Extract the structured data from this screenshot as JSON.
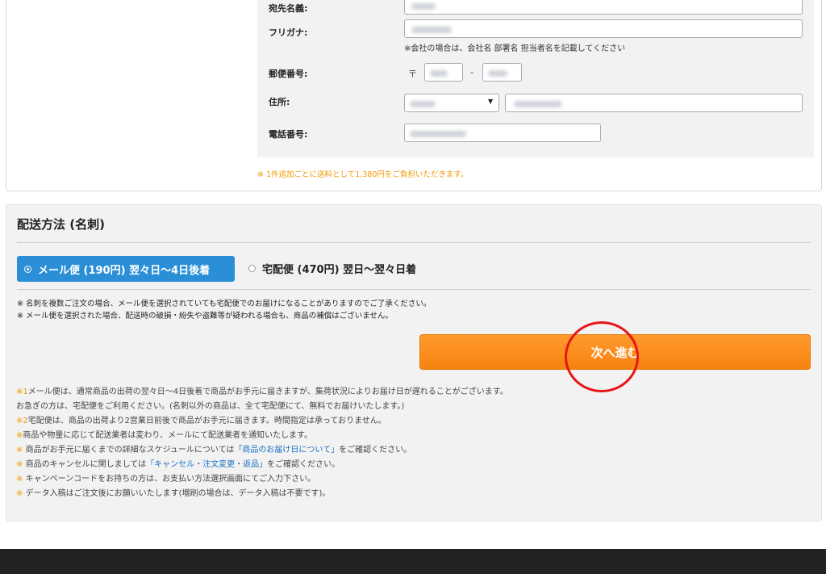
{
  "form": {
    "name_label": "宛先名義:",
    "kana_label": "フリガナ:",
    "kana_note": "※会社の場合は、会社名 部署名 担当者名を記載してください",
    "zip_label": "郵便番号:",
    "zip_mark": "〒",
    "zip_dash": "-",
    "address_label": "住所:",
    "select_arrow": "▼",
    "phone_label": "電話番号:",
    "extra_fee_note": "※ 1件追加ごとに送料として1,380円をご負担いただきます。"
  },
  "shipping": {
    "title": "配送方法 (名刺)",
    "option_mail": "メール便 (190円) 翌々日～4日後着",
    "option_home": "宅配便 (470円) 翌日～翌々日着",
    "selected": "mail",
    "warning_1": "※ 名刺を複数ご注文の場合、メール便を選択されていても宅配便でのお届けになることがありますのでご了承ください。",
    "warning_2": "※ メール便を選択された場合、配送時の破損・紛失や盗難等が疑われる場合も、商品の補償はございません。",
    "next_button": "次へ進む"
  },
  "notes": [
    {
      "mark": "※1",
      "text": "メール便は、通常商品の出荷の翌々日～4日後着で商品がお手元に届きますが、集荷状況によりお届け日が遅れることがございます。"
    },
    {
      "mark": "",
      "text": "お急ぎの方は、宅配便をご利用ください。(名刺以外の商品は、全て宅配便にて、無料でお届けいたします。)"
    },
    {
      "mark": "※2",
      "text": "宅配便は、商品の出荷より2営業日前後で商品がお手元に届きます。時間指定は承っておりません。"
    },
    {
      "mark": "※",
      "text": "商品や物量に応じて配送業者は変わり、メールにて配送業者を通知いたします。"
    },
    {
      "mark": "※",
      "pre": " 商品がお手元に届くまでの詳細なスケジュールについては",
      "link": "「商品のお届け日について」",
      "post": "をご確認ください。"
    },
    {
      "mark": "※",
      "pre": " 商品のキャンセルに関しましては",
      "link": "「キャンセル・注文変更・返品」",
      "post": "をご確認ください。"
    },
    {
      "mark": "※",
      "text": " キャンペーンコードをお持ちの方は、お支払い方法選択画面にてご入力下さい。"
    },
    {
      "mark": "※",
      "text": " データ入稿はご注文後にお願いいたします(増刷の場合は、データ入稿は不要です)。"
    }
  ],
  "colors": {
    "accent_blue": "#2a8fd6",
    "button_orange": "#f7820f",
    "note_orange": "#f39800",
    "annotation_red": "#e81515",
    "footer": "#222222"
  }
}
